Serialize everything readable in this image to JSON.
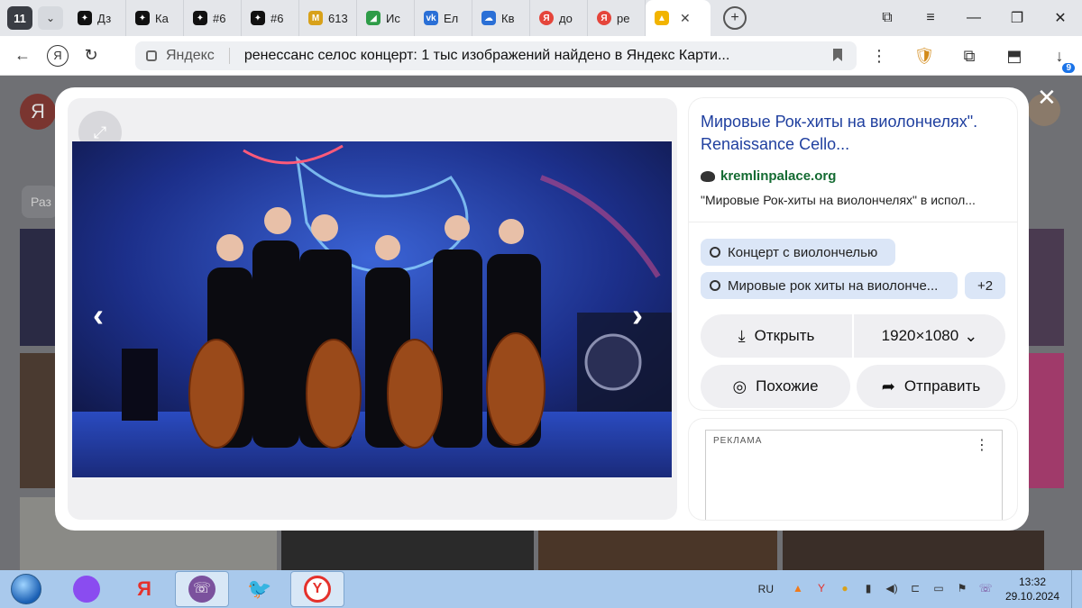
{
  "browser": {
    "tab_count": "11",
    "tabs": [
      {
        "label": "Дз",
        "fav": "✦",
        "color": "#111"
      },
      {
        "label": "Ка",
        "fav": "✦",
        "color": "#111"
      },
      {
        "label": "#6",
        "fav": "✦",
        "color": "#111"
      },
      {
        "label": "#6",
        "fav": "✦",
        "color": "#111"
      },
      {
        "label": "613",
        "fav": "M",
        "color": "#d8a11a"
      },
      {
        "label": "Ис",
        "fav": "◢",
        "color": "#2e9c48"
      },
      {
        "label": "Ел",
        "fav": "vk",
        "color": "#2a6fd6"
      },
      {
        "label": "Кв",
        "fav": "☁",
        "color": "#2a6fd6"
      },
      {
        "label": "до",
        "fav": "Я",
        "color": "#e5453b"
      },
      {
        "label": "ре",
        "fav": "Я",
        "color": "#e5453b"
      }
    ],
    "active_tab_close": "✕",
    "url_domain": "Яндекс",
    "url_text": "ренессанс селос концерт: 1 тыс изображений найдено в Яндекс Карти...",
    "downloads_count": "9"
  },
  "modal": {
    "close_label": "✕",
    "info": {
      "title": "Мировые Рок-хиты на виолончелях\". Renaissance Cello...",
      "source": "kremlinpalace.org",
      "description": "\"Мировые Рок-хиты на виолончелях\" в испол...",
      "tags": [
        "Концерт с виолончелью",
        "Мировые рок хиты на виолонче..."
      ],
      "more_tags": "+2",
      "open_label": "Открыть",
      "size_label": "1920×1080",
      "similar_label": "Похожие",
      "share_label": "Отправить"
    },
    "ad_label": "РЕКЛАМА"
  },
  "page": {
    "chip_label": "Раз"
  },
  "taskbar": {
    "lang": "RU",
    "time": "13:32",
    "date": "29.10.2024"
  }
}
